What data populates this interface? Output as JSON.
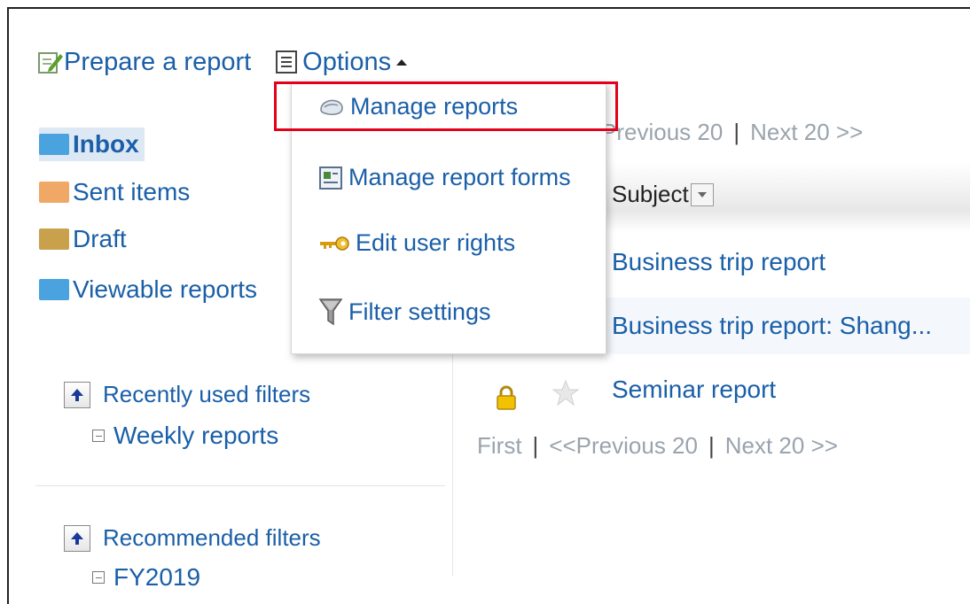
{
  "toolbar": {
    "prepare_label": "Prepare a report",
    "options_label": "Options"
  },
  "options_menu": {
    "items": [
      {
        "label": "Manage reports",
        "icon": "manage-reports-icon"
      },
      {
        "label": "Manage report forms",
        "icon": "report-forms-icon"
      },
      {
        "label": "Edit user rights",
        "icon": "key-icon"
      },
      {
        "label": "Filter settings",
        "icon": "funnel-icon"
      }
    ],
    "highlighted_item": "Manage reports",
    "highlight_color": "#e3001b"
  },
  "folders": [
    {
      "label": "Inbox",
      "color": "#4aa3df",
      "active": true
    },
    {
      "label": "Sent items",
      "color": "#f0a866"
    },
    {
      "label": "Draft",
      "color": "#c9a04c"
    },
    {
      "label": "Viewable reports",
      "color": "#4aa3df"
    }
  ],
  "filters": {
    "recent": {
      "title": "Recently used filters",
      "items": [
        "Weekly reports"
      ]
    },
    "recommended": {
      "title": "Recommended filters",
      "items": [
        "FY2019"
      ]
    }
  },
  "list": {
    "pager_top": {
      "prev": "Previous 20",
      "sep": "|",
      "next": "Next 20 >>"
    },
    "column_subject": "Subject",
    "rows": [
      {
        "subject": "Business trip report"
      },
      {
        "subject": "Business trip report: Shang..."
      },
      {
        "subject": "Seminar report",
        "locked": true,
        "starred": false
      }
    ],
    "pager_bottom": {
      "first": "First",
      "sep": "|",
      "prev": "<<Previous 20",
      "next": "Next 20 >>"
    }
  },
  "colors": {
    "link": "#1a5fa8",
    "muted": "#9aa3ad",
    "selected_bg": "#dde8f5"
  }
}
